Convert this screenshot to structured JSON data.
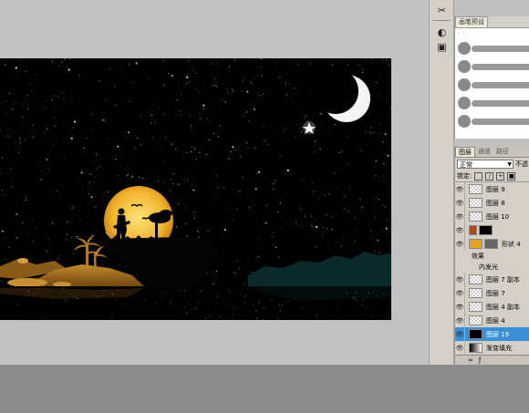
{
  "brush_panel": {
    "tab_label": "画笔预设",
    "brush_count": 5
  },
  "layers_panel": {
    "tabs": [
      "图层",
      "通道",
      "路径"
    ],
    "blend_mode": "正常",
    "opacity_label": "不透",
    "lock_label": "锁定:",
    "layers": [
      {
        "name": "图层 9",
        "thumb": "transparent"
      },
      {
        "name": "图层 8",
        "thumb": "transparent"
      },
      {
        "name": "图层 10",
        "thumb": "transparent"
      },
      {
        "name": "",
        "thumb": "black-shape",
        "color": "#b84a10"
      },
      {
        "name": "形状 4",
        "thumb": "yellow",
        "color": "#e8a020"
      },
      {
        "name": "效果",
        "type": "effect"
      },
      {
        "name": "内发光",
        "type": "effect-sub"
      },
      {
        "name": "图层 7 副本",
        "thumb": "transparent"
      },
      {
        "name": "图层 7",
        "thumb": "transparent"
      },
      {
        "name": "图层 4 副本",
        "thumb": "transparent"
      },
      {
        "name": "图层 4",
        "thumb": "transparent"
      },
      {
        "name": "图层 19",
        "thumb": "black",
        "selected": true
      },
      {
        "name": "渐变填充",
        "thumb": "gradient"
      }
    ]
  },
  "colors": {
    "sky": "#000000",
    "moon": "#f4f4f4",
    "sun": "#f2b32a",
    "island": "#a86f1e",
    "selected_layer": "#3a8fd6"
  }
}
